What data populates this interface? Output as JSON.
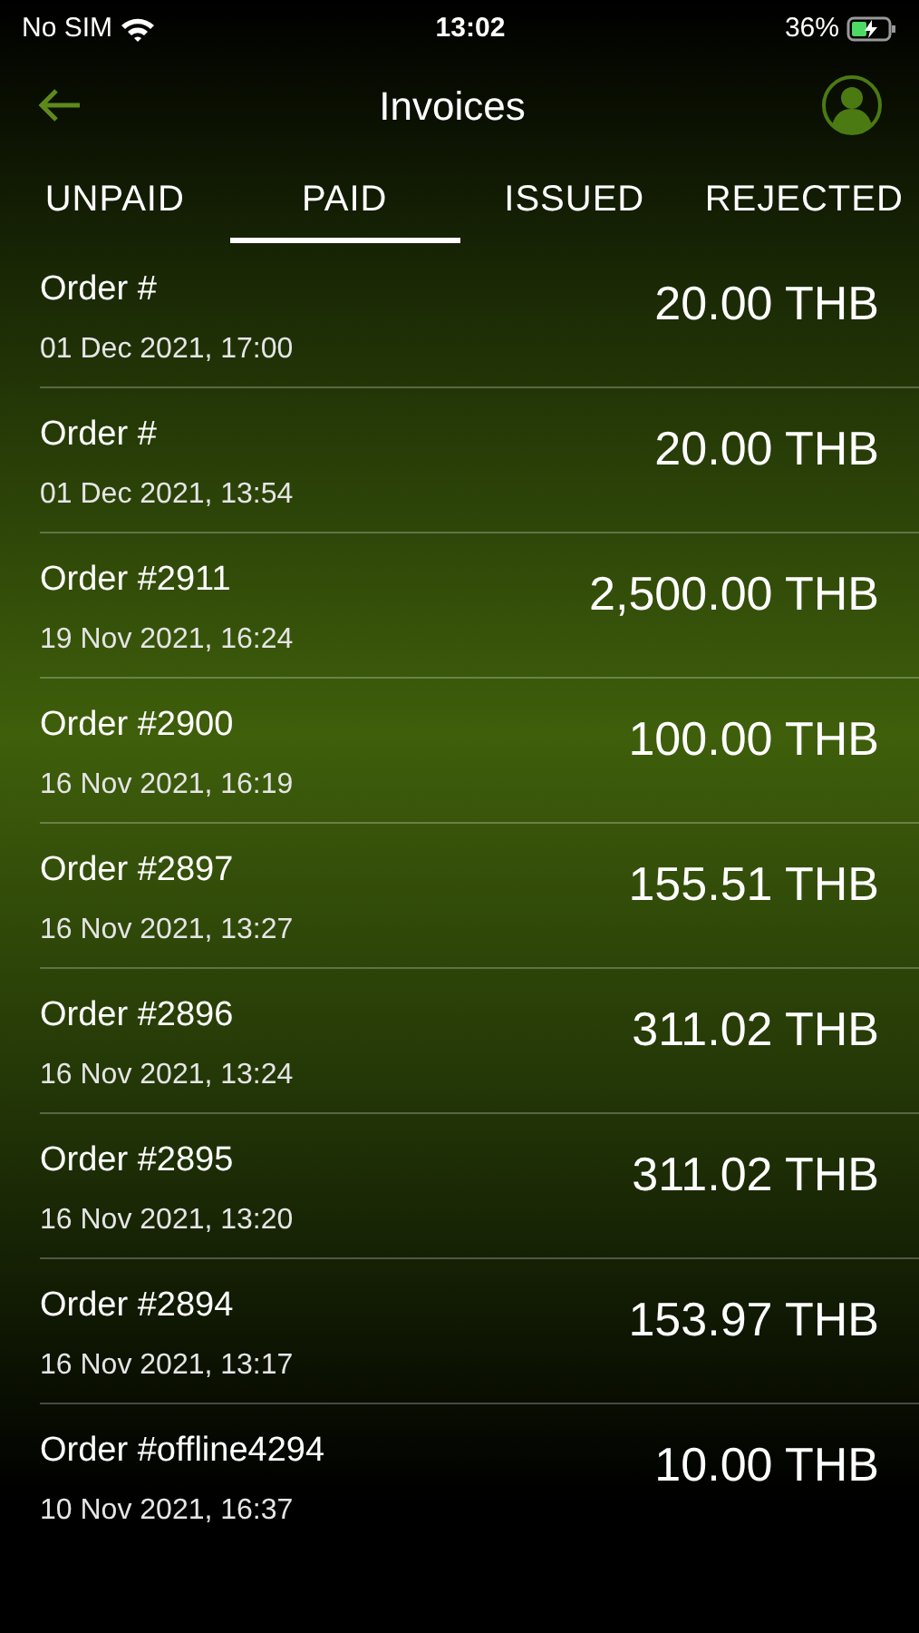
{
  "status_bar": {
    "carrier": "No SIM",
    "time": "13:02",
    "battery": "36%"
  },
  "header": {
    "title": "Invoices"
  },
  "tabs": [
    {
      "label": "UNPAID",
      "selected": false
    },
    {
      "label": "PAID",
      "selected": true
    },
    {
      "label": "ISSUED",
      "selected": false
    },
    {
      "label": "REJECTED",
      "selected": false
    }
  ],
  "orders": [
    {
      "order": "Order #",
      "date": "01 Dec 2021, 17:00",
      "amount": "20.00 THB"
    },
    {
      "order": "Order #",
      "date": "01 Dec 2021, 13:54",
      "amount": "20.00 THB"
    },
    {
      "order": "Order #2911",
      "date": "19 Nov 2021, 16:24",
      "amount": "2,500.00 THB"
    },
    {
      "order": "Order #2900",
      "date": "16 Nov 2021, 16:19",
      "amount": "100.00 THB"
    },
    {
      "order": "Order #2897",
      "date": "16 Nov 2021, 13:27",
      "amount": "155.51 THB"
    },
    {
      "order": "Order #2896",
      "date": "16 Nov 2021, 13:24",
      "amount": "311.02 THB"
    },
    {
      "order": "Order #2895",
      "date": "16 Nov 2021, 13:20",
      "amount": "311.02 THB"
    },
    {
      "order": "Order #2894",
      "date": "16 Nov 2021, 13:17",
      "amount": "153.97 THB"
    },
    {
      "order": "Order #offline4294",
      "date": "10 Nov 2021, 16:37",
      "amount": "10.00 THB"
    }
  ]
}
